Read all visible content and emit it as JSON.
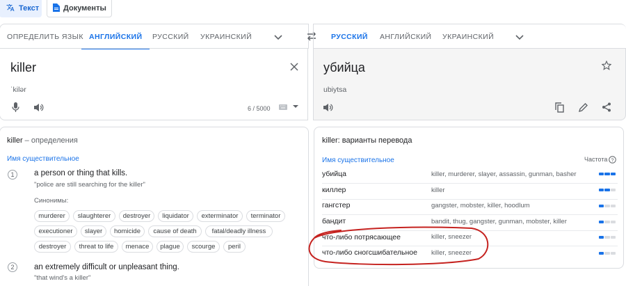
{
  "modes": {
    "text_label": "Текст",
    "docs_label": "Документы"
  },
  "source_langs": [
    "ОПРЕДЕЛИТЬ ЯЗЫК",
    "АНГЛИЙСКИЙ",
    "РУССКИЙ",
    "УКРАИНСКИЙ"
  ],
  "target_langs": [
    "РУССКИЙ",
    "АНГЛИЙСКИЙ",
    "УКРАИНСКИЙ"
  ],
  "source": {
    "text": "killer",
    "transcription": "ˈkilər",
    "char_count": "6 / 5000"
  },
  "target": {
    "text": "убийца",
    "transliteration": "ubiytsa"
  },
  "definitions": {
    "word": "killer",
    "title_suffix": " – определения",
    "part_of_speech": "Имя существительное",
    "synonyms_label": "Синонимы:",
    "entries": [
      {
        "num": "1",
        "text": "a person or thing that kills.",
        "example": "\"police are still searching for the killer\"",
        "synonyms": [
          "murderer",
          "slaughterer",
          "destroyer",
          "liquidator",
          "exterminator",
          "terminator",
          "executioner",
          "slayer",
          "homicide",
          "cause of death",
          "fatal/deadly illness",
          "destroyer",
          "threat to life",
          "menace",
          "plague",
          "scourge",
          "peril"
        ]
      },
      {
        "num": "2",
        "text": "an extremely difficult or unpleasant thing.",
        "example": "\"that wind's a killer\""
      }
    ]
  },
  "translations": {
    "word": "killer",
    "title_suffix": ": варианты перевода",
    "part_of_speech": "Имя существительное",
    "frequency_label": "Частота",
    "rows": [
      {
        "word": "убийца",
        "back": "killer, murderer, slayer, assassin, gunman, basher",
        "frequency": 3
      },
      {
        "word": "киллер",
        "back": "killer",
        "frequency": 2
      },
      {
        "word": "гангстер",
        "back": "gangster, mobster, killer, hoodlum",
        "frequency": 1
      },
      {
        "word": "бандит",
        "back": "bandit, thug, gangster, gunman, mobster, killer",
        "frequency": 1
      },
      {
        "word": "что-либо потрясающее",
        "back": "killer, sneezer",
        "frequency": 1
      },
      {
        "word": "что-либо сногсшибательное",
        "back": "killer, sneezer",
        "frequency": 1
      }
    ]
  },
  "colors": {
    "accent": "#1a73e8",
    "annotation": "#c5221f"
  }
}
